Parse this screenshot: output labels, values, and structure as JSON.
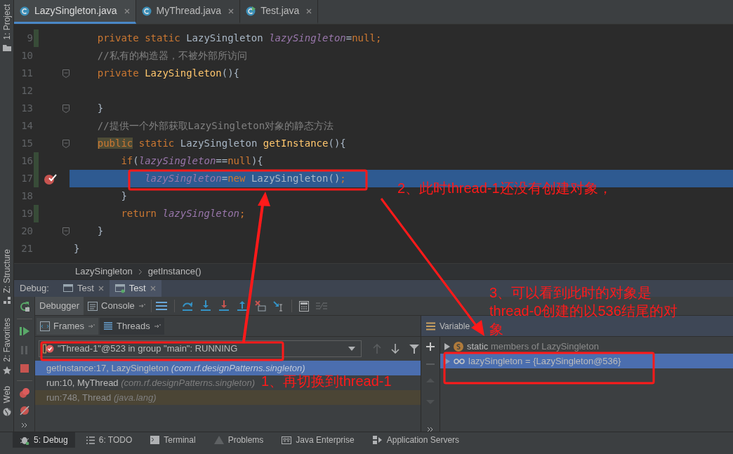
{
  "tool_strip": [
    {
      "kind": "project",
      "label": "1: Project"
    },
    {
      "kind": "structure",
      "label": "Z: Structure"
    },
    {
      "kind": "favorites",
      "label": "2: Favorites"
    },
    {
      "kind": "web",
      "label": "Web"
    }
  ],
  "editor_tabs": [
    {
      "label": "LazySingleton.java",
      "kind": "class",
      "selected": true
    },
    {
      "label": "MyThread.java",
      "kind": "class",
      "selected": false
    },
    {
      "label": "Test.java",
      "kind": "test",
      "selected": false
    }
  ],
  "code_lines": [
    {
      "number": "9",
      "changed": true,
      "breakpoint": false,
      "fold": false,
      "highlighted": false,
      "tokens": [
        {
          "kind": "keyword",
          "text": "    private static "
        },
        {
          "kind": "plain",
          "text": "LazySingleton "
        },
        {
          "kind": "field",
          "text": "lazySingleton"
        },
        {
          "kind": "plain",
          "text": "="
        },
        {
          "kind": "keyword",
          "text": "null;"
        }
      ]
    },
    {
      "number": "10",
      "changed": false,
      "breakpoint": false,
      "fold": false,
      "highlighted": false,
      "tokens": [
        {
          "kind": "comment",
          "text": "    //私有的构造器，不被外部所访问"
        }
      ]
    },
    {
      "number": "11",
      "changed": false,
      "breakpoint": false,
      "fold": true,
      "highlighted": false,
      "tokens": [
        {
          "kind": "keyword",
          "text": "    private "
        },
        {
          "kind": "method",
          "text": "LazySingleton"
        },
        {
          "kind": "plain",
          "text": "(){"
        }
      ]
    },
    {
      "number": "12",
      "changed": false,
      "breakpoint": false,
      "fold": false,
      "highlighted": false
    },
    {
      "number": "13",
      "changed": false,
      "breakpoint": false,
      "fold": true,
      "highlighted": false,
      "tokens": [
        {
          "kind": "plain",
          "text": "    }"
        }
      ]
    },
    {
      "number": "14",
      "changed": false,
      "breakpoint": false,
      "fold": false,
      "highlighted": false,
      "tokens": [
        {
          "kind": "comment",
          "text": "    //提供一个外部获取LazySingleton对象的静态方法"
        }
      ]
    },
    {
      "number": "15",
      "changed": false,
      "breakpoint": false,
      "fold": true,
      "highlighted": false,
      "tokens": [
        {
          "kind": "keyword_marked",
          "text": "    public"
        },
        {
          "kind": "keyword",
          "text": " static "
        },
        {
          "kind": "plain",
          "text": "LazySingleton "
        },
        {
          "kind": "method",
          "text": "getInstance"
        },
        {
          "kind": "plain",
          "text": "(){"
        }
      ]
    },
    {
      "number": "16",
      "changed": true,
      "breakpoint": false,
      "fold": false,
      "highlighted": false,
      "tokens": [
        {
          "kind": "keyword",
          "text": "        if"
        },
        {
          "kind": "plain",
          "text": "("
        },
        {
          "kind": "field",
          "text": "lazySingleton"
        },
        {
          "kind": "plain",
          "text": "=="
        },
        {
          "kind": "keyword",
          "text": "null"
        },
        {
          "kind": "plain",
          "text": "){"
        }
      ]
    },
    {
      "number": "17",
      "changed": true,
      "breakpoint": true,
      "fold": false,
      "highlighted": true,
      "tokens": [
        {
          "kind": "field",
          "text": "            lazySingleton"
        },
        {
          "kind": "plain",
          "text": "="
        },
        {
          "kind": "keyword",
          "text": "new"
        },
        {
          "kind": "plain",
          "text": " LazySingleton()"
        },
        {
          "kind": "keyword",
          "text": ";"
        }
      ]
    },
    {
      "number": "18",
      "changed": false,
      "breakpoint": false,
      "fold": false,
      "highlighted": false,
      "tokens": [
        {
          "kind": "plain",
          "text": "        }"
        }
      ]
    },
    {
      "number": "19",
      "changed": true,
      "breakpoint": false,
      "fold": false,
      "highlighted": false,
      "tokens": [
        {
          "kind": "keyword",
          "text": "        return "
        },
        {
          "kind": "field",
          "text": "lazySingleton"
        },
        {
          "kind": "keyword",
          "text": ";"
        }
      ]
    },
    {
      "number": "20",
      "changed": false,
      "breakpoint": false,
      "fold": true,
      "highlighted": false,
      "tokens": [
        {
          "kind": "plain",
          "text": "    }"
        }
      ]
    },
    {
      "number": "21",
      "changed": false,
      "breakpoint": false,
      "fold": false,
      "highlighted": false,
      "tokens": [
        {
          "kind": "plain",
          "text": "}"
        }
      ]
    }
  ],
  "breadcrumb": [
    "LazySingleton",
    "getInstance()"
  ],
  "debug": {
    "title": "Debug:",
    "tabs": [
      {
        "label": "Test",
        "selected": false
      },
      {
        "label": "Test",
        "selected": true
      }
    ],
    "views": [
      {
        "label": "Debugger",
        "kind": "debugger",
        "selected": true
      },
      {
        "label": "Console",
        "kind": "console",
        "selected": false
      }
    ],
    "panels": [
      {
        "label": "Frames",
        "kind": "frames"
      },
      {
        "label": "Threads",
        "kind": "threads"
      }
    ],
    "thread_selector": "\"Thread-1\"@523 in group \"main\": RUNNING",
    "frames": [
      {
        "method": "getInstance:17, LazySingleton",
        "package": "(com.rf.designPatterns.singleton)",
        "kind": "app",
        "selected": true
      },
      {
        "method": "run:10, MyThread",
        "package": "(com.rf.designPatterns.singleton)",
        "kind": "app",
        "selected": false
      },
      {
        "method": "run:748, Thread",
        "package": "(java.lang)",
        "kind": "library",
        "selected": false
      }
    ],
    "variables_title": "Variable",
    "variables": [
      {
        "kind": "static",
        "name": "static",
        "detail": "members of LazySingleton",
        "selected": false
      },
      {
        "kind": "field",
        "name": "lazySingleton = {LazySingleton@536}",
        "selected": true
      }
    ]
  },
  "bottom_tools": [
    {
      "label": "5: Debug",
      "kind": "debug",
      "selected": true
    },
    {
      "label": "6: TODO",
      "kind": "todo",
      "selected": false
    },
    {
      "label": "Terminal",
      "kind": "terminal",
      "selected": false
    },
    {
      "label": "Problems",
      "kind": "problems",
      "selected": false
    },
    {
      "label": "Java Enterprise",
      "kind": "enterprise",
      "selected": false
    },
    {
      "label": "Application Servers",
      "kind": "servers",
      "selected": false
    }
  ],
  "annotations": [
    "1、再切换到thread-1",
    "2、此时thread-1还没有创建对象，",
    "3、可以看到此时的对象是thread-0创建的以536结尾的对象"
  ]
}
